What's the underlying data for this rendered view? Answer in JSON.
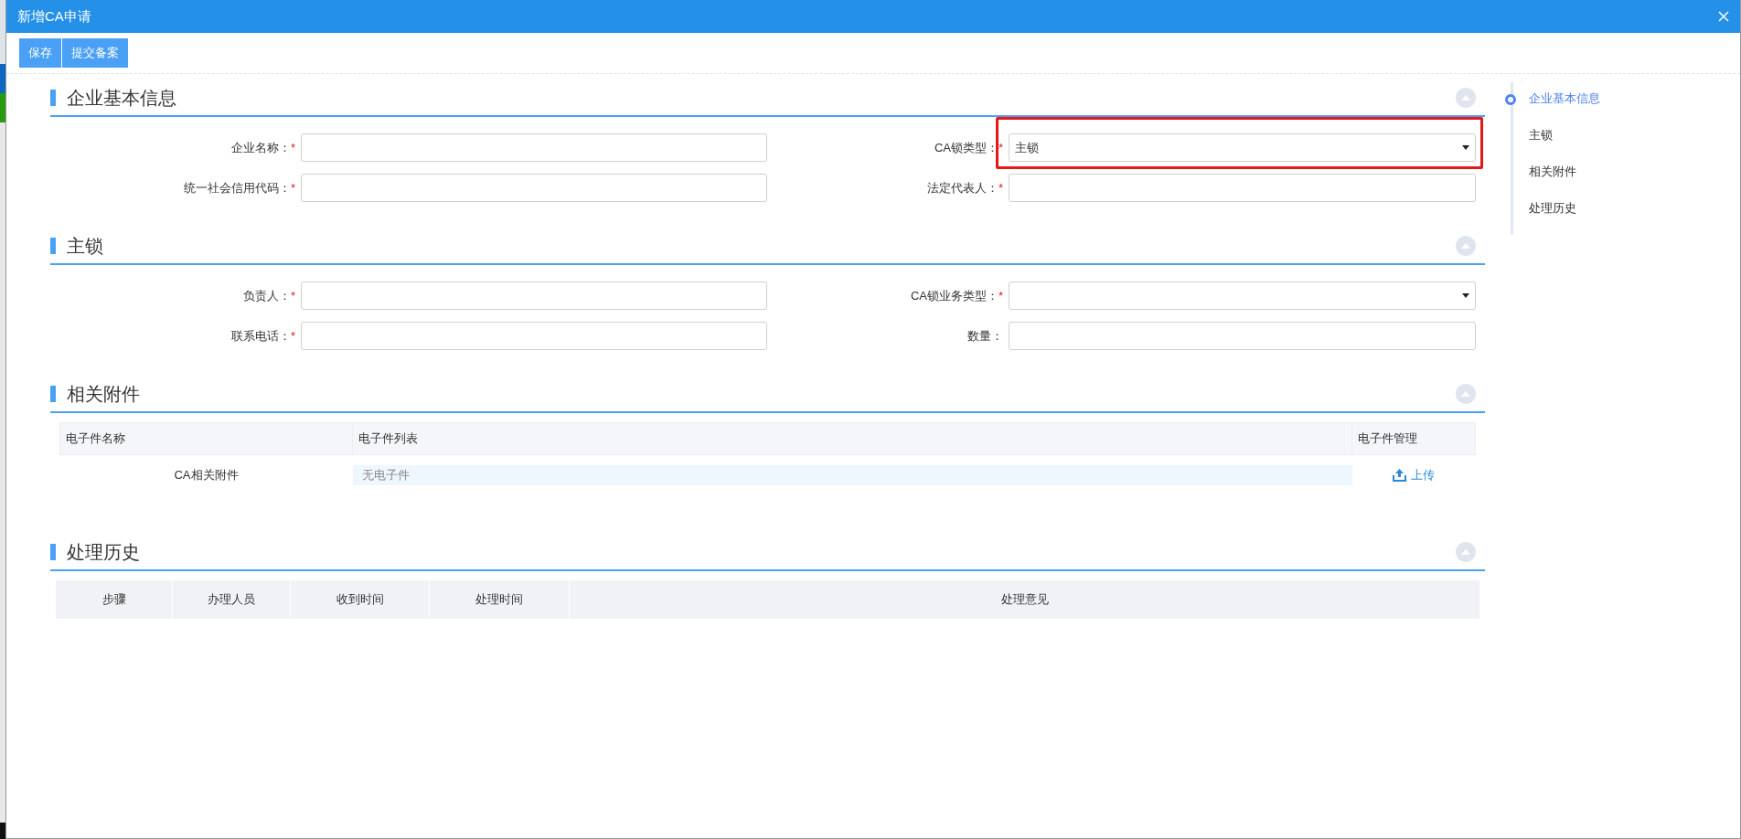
{
  "window": {
    "title": "新增CA申请"
  },
  "toolbar": [
    {
      "label": "保存"
    },
    {
      "label": "提交备案"
    }
  ],
  "sections": [
    {
      "title": "企业基本信息",
      "kind": "form",
      "fields": [
        {
          "label": "企业名称：",
          "required_mark": "*",
          "kind": "text",
          "highlighted": false
        },
        {
          "label": "CA锁类型：",
          "required_mark": "*",
          "kind": "select",
          "value": "主锁",
          "highlighted": true
        },
        {
          "label": "统一社会信用代码：",
          "required_mark": "*",
          "kind": "text",
          "highlighted": false
        },
        {
          "label": "法定代表人：",
          "required_mark": "*",
          "kind": "text",
          "highlighted": false
        }
      ]
    },
    {
      "title": "主锁",
      "kind": "form",
      "fields": [
        {
          "label": "负责人：",
          "required_mark": "*",
          "kind": "text",
          "highlighted": false
        },
        {
          "label": "CA锁业务类型：",
          "required_mark": "*",
          "kind": "select",
          "highlighted": false
        },
        {
          "label": "联系电话：",
          "required_mark": "*",
          "kind": "text",
          "highlighted": false
        },
        {
          "label": "数量：",
          "kind": "text",
          "highlighted": false
        }
      ]
    },
    {
      "title": "相关附件",
      "kind": "attachments",
      "columns": [
        "电子件名称",
        "电子件列表",
        "电子件管理"
      ],
      "rows": [
        {
          "name": "CA相关附件",
          "files": "无电子件",
          "action": "上传"
        }
      ]
    },
    {
      "title": "处理历史",
      "kind": "history",
      "columns": [
        "步骤",
        "办理人员",
        "收到时间",
        "处理时间",
        "处理意见"
      ]
    }
  ],
  "nav": [
    {
      "label": "企业基本信息",
      "selected": true
    },
    {
      "label": "主锁",
      "selected": false
    },
    {
      "label": "相关附件",
      "selected": false
    },
    {
      "label": "处理历史",
      "selected": false
    }
  ]
}
